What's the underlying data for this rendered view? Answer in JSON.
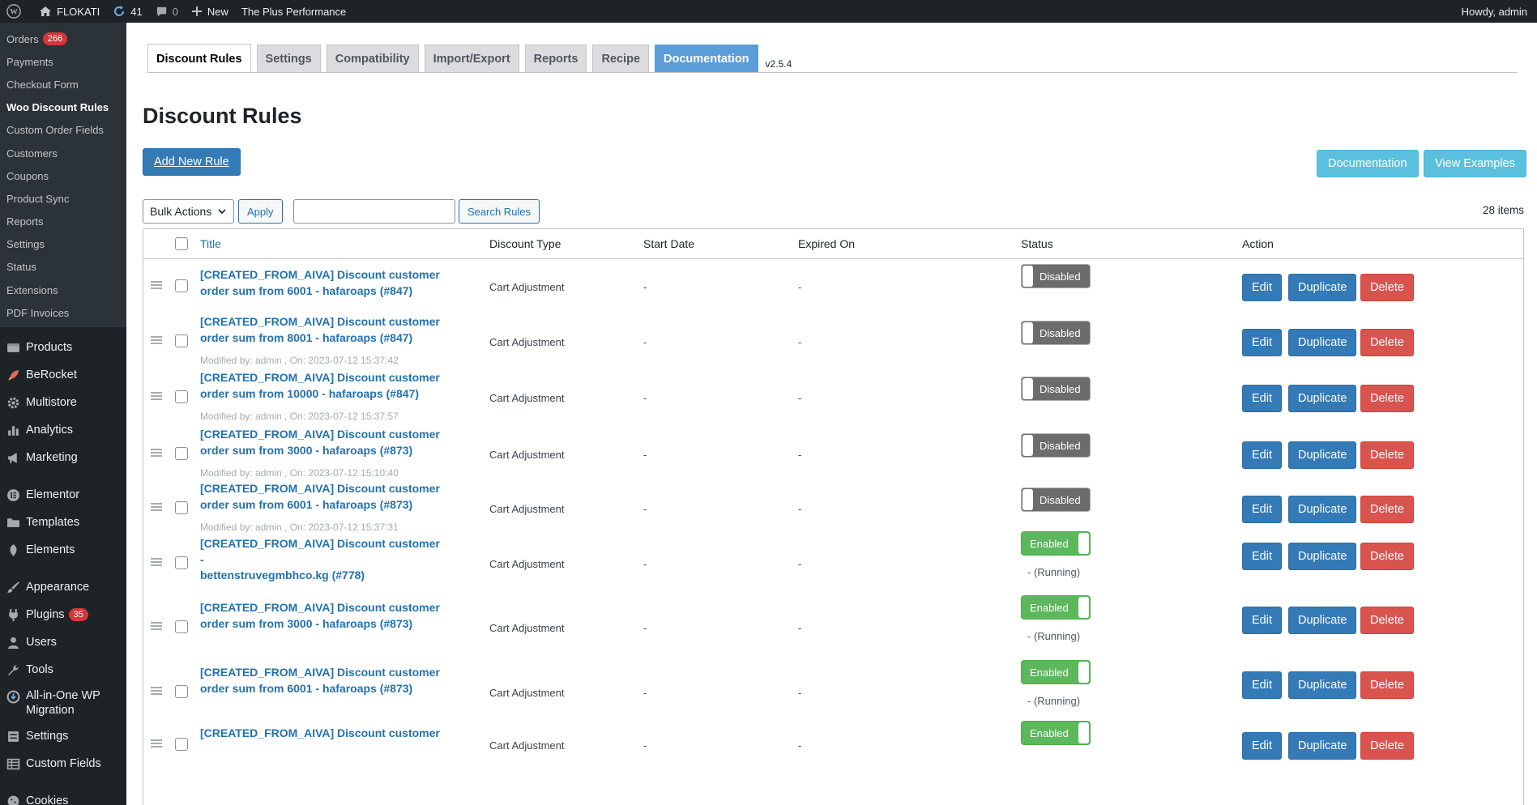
{
  "adminbar": {
    "site_name": "FLOKATI",
    "updates": "41",
    "comments": "0",
    "new_label": "New",
    "perf_label": "The Plus Performance",
    "howdy": "Howdy, admin"
  },
  "sidebar": {
    "submenu": [
      {
        "label": "Orders",
        "badge": "266"
      },
      {
        "label": "Payments"
      },
      {
        "label": "Checkout Form"
      },
      {
        "label": "Woo Discount Rules",
        "current": true
      },
      {
        "label": "Custom Order Fields"
      },
      {
        "label": "Customers"
      },
      {
        "label": "Coupons"
      },
      {
        "label": "Product Sync"
      },
      {
        "label": "Reports"
      },
      {
        "label": "Settings"
      },
      {
        "label": "Status"
      },
      {
        "label": "Extensions"
      },
      {
        "label": "PDF Invoices"
      }
    ],
    "menu": [
      {
        "label": "Products",
        "icon": "products-icon"
      },
      {
        "label": "BeRocket",
        "icon": "rocket-icon"
      },
      {
        "label": "Multistore",
        "icon": "gear-icon"
      },
      {
        "label": "Analytics",
        "icon": "bar-chart-icon"
      },
      {
        "label": "Marketing",
        "icon": "megaphone-icon"
      },
      {
        "sep": true
      },
      {
        "label": "Elementor",
        "icon": "elementor-icon"
      },
      {
        "label": "Templates",
        "icon": "folder-icon"
      },
      {
        "label": "Elements",
        "icon": "elements-icon"
      },
      {
        "sep": true
      },
      {
        "label": "Appearance",
        "icon": "brush-icon"
      },
      {
        "label": "Plugins",
        "icon": "plug-icon",
        "badge": "35"
      },
      {
        "label": "Users",
        "icon": "user-icon"
      },
      {
        "label": "Tools",
        "icon": "wrench-icon"
      },
      {
        "label": "All-in-One WP Migration",
        "icon": "migration-icon",
        "two_line": true
      },
      {
        "label": "Settings",
        "icon": "settings-icon"
      },
      {
        "label": "Custom Fields",
        "icon": "table-icon"
      },
      {
        "sep": true
      },
      {
        "label": "Cookies",
        "icon": "cookie-icon"
      }
    ]
  },
  "tabs": [
    {
      "label": "Discount Rules",
      "active": true
    },
    {
      "label": "Settings"
    },
    {
      "label": "Compatibility"
    },
    {
      "label": "Import/Export"
    },
    {
      "label": "Reports"
    },
    {
      "label": "Recipe"
    },
    {
      "label": "Documentation",
      "doc": true
    }
  ],
  "version": "v2.5.4",
  "page_title": "Discount Rules",
  "buttons": {
    "add_new": "Add New Rule",
    "documentation": "Documentation",
    "view_examples": "View Examples",
    "bulk_actions": "Bulk Actions",
    "apply": "Apply",
    "search": "Search Rules"
  },
  "search": {
    "value": ""
  },
  "items_count": "28 items",
  "table": {
    "headers": {
      "title": "Title",
      "discount_type": "Discount Type",
      "start_date": "Start Date",
      "expired_on": "Expired On",
      "status": "Status",
      "action": "Action"
    },
    "action_labels": {
      "edit": "Edit",
      "duplicate": "Duplicate",
      "delete": "Delete"
    },
    "rows": [
      {
        "title1": "[CREATED_FROM_AIVA] Discount customer",
        "title2": "order sum from 6001 - hafaroaps (#847)",
        "modified": "",
        "type": "Cart Adjustment",
        "start": "-",
        "expired": "-",
        "status": "Disabled",
        "enabled": false,
        "running": ""
      },
      {
        "title1": "[CREATED_FROM_AIVA] Discount customer",
        "title2": "order sum from 8001 - hafaroaps (#847)",
        "modified": "Modified by: admin , On: 2023-07-12 15:37:42",
        "type": "Cart Adjustment",
        "start": "-",
        "expired": "-",
        "status": "Disabled",
        "enabled": false,
        "running": ""
      },
      {
        "title1": "[CREATED_FROM_AIVA] Discount customer",
        "title2": "order sum from 10000 - hafaroaps (#847)",
        "modified": "Modified by: admin , On: 2023-07-12 15:37:57",
        "type": "Cart Adjustment",
        "start": "-",
        "expired": "-",
        "status": "Disabled",
        "enabled": false,
        "running": ""
      },
      {
        "title1": "[CREATED_FROM_AIVA] Discount customer",
        "title2": "order sum from 3000 - hafaroaps (#873)",
        "modified": "Modified by: admin , On: 2023-07-12 15:10:40",
        "type": "Cart Adjustment",
        "start": "-",
        "expired": "-",
        "status": "Disabled",
        "enabled": false,
        "running": ""
      },
      {
        "title1": "[CREATED_FROM_AIVA] Discount customer",
        "title2": "order sum from 6001 - hafaroaps (#873)",
        "modified": "Modified by: admin , On: 2023-07-12 15:37:31",
        "type": "Cart Adjustment",
        "start": "-",
        "expired": "-",
        "status": "Disabled",
        "enabled": false,
        "running": ""
      },
      {
        "title1": "[CREATED_FROM_AIVA] Discount customer -",
        "title2": "bettenstruvegmbhco.kg (#778)",
        "modified": "",
        "type": "Cart Adjustment",
        "start": "-",
        "expired": "-",
        "status": "Enabled",
        "enabled": true,
        "running": "- (Running)"
      },
      {
        "title1": "[CREATED_FROM_AIVA] Discount customer",
        "title2": "order sum from 3000 - hafaroaps (#873)",
        "modified": "",
        "type": "Cart Adjustment",
        "start": "-",
        "expired": "-",
        "status": "Enabled",
        "enabled": true,
        "running": "- (Running)"
      },
      {
        "title1": "[CREATED_FROM_AIVA] Discount customer",
        "title2": "order sum from 6001 - hafaroaps (#873)",
        "modified": "",
        "type": "Cart Adjustment",
        "start": "-",
        "expired": "-",
        "status": "Enabled",
        "enabled": true,
        "running": "- (Running)"
      },
      {
        "title1": "[CREATED_FROM_AIVA] Discount customer",
        "title2": "",
        "modified": "",
        "type": "Cart Adjustment",
        "start": "-",
        "expired": "-",
        "status": "Enabled",
        "enabled": true,
        "running": ""
      }
    ]
  }
}
